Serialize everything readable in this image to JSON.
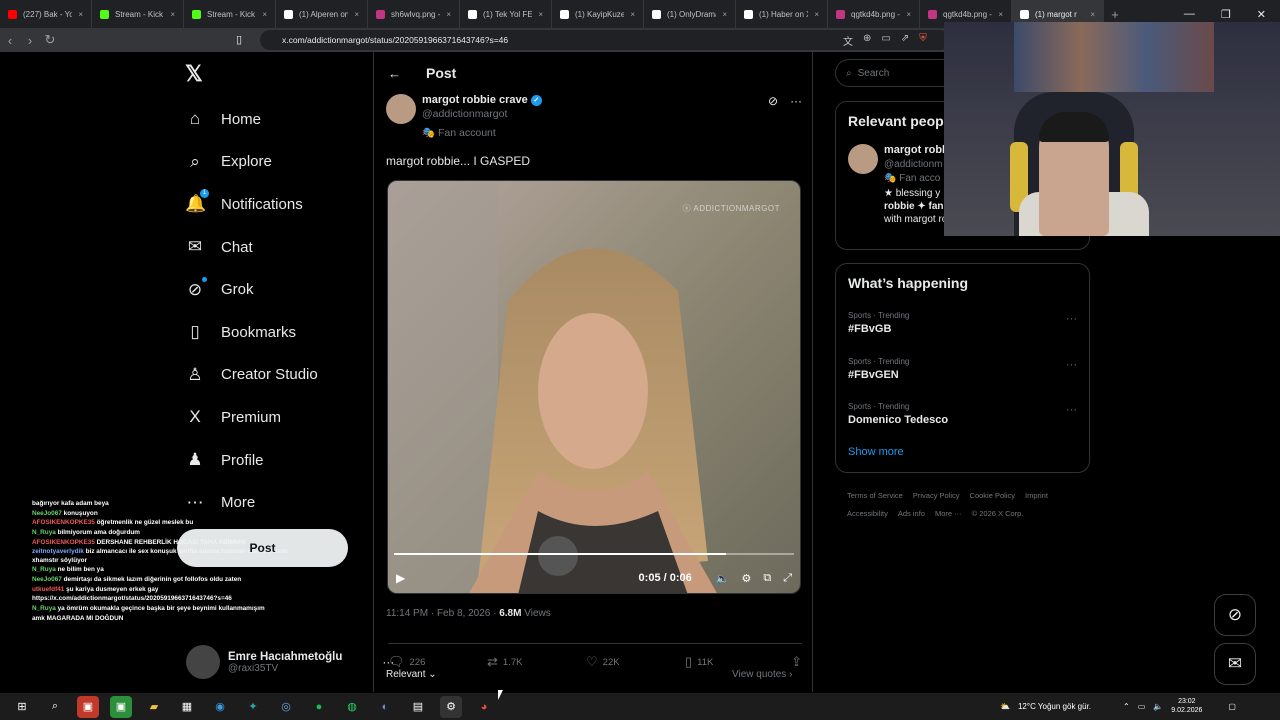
{
  "browser": {
    "tabs": [
      {
        "title": "(227) Bak - YouTu",
        "icon": "youtube-icon",
        "color": "#ff0000",
        "active": false
      },
      {
        "title": "Stream - Kick Das",
        "icon": "kick-icon",
        "color": "#53fc18",
        "active": false
      },
      {
        "title": "Stream - Kick Das",
        "icon": "kick-icon",
        "color": "#53fc18",
        "active": false
      },
      {
        "title": "(1) Alperen on X",
        "icon": "x-icon",
        "color": "#ffffff",
        "active": false
      },
      {
        "title": "sh6wlvq.png - Ho",
        "icon": "image-icon",
        "color": "#c13584",
        "active": false
      },
      {
        "title": "(1) Tek Yol FENER",
        "icon": "x-icon",
        "color": "#ffffff",
        "active": false
      },
      {
        "title": "(1) KayipKuzey o",
        "icon": "x-icon",
        "color": "#ffffff",
        "active": false
      },
      {
        "title": "(1) OnlyDrama o",
        "icon": "x-icon",
        "color": "#ffffff",
        "active": false
      },
      {
        "title": "(1) Haber on X",
        "icon": "x-icon",
        "color": "#ffffff",
        "active": false
      },
      {
        "title": "qgtkd4b.png - H",
        "icon": "image-icon",
        "color": "#c13584",
        "active": false
      },
      {
        "title": "qgtkd4b.png - H",
        "icon": "image-icon",
        "color": "#c13584",
        "active": false
      },
      {
        "title": "(1) margot r",
        "icon": "x-icon",
        "color": "#ffffff",
        "active": true
      }
    ],
    "url": "x.com/addictionmargot/status/2020591966371643746?s=46"
  },
  "sidebar": {
    "items": [
      {
        "label": "Home",
        "icon": "home-icon",
        "glyph": "⌂"
      },
      {
        "label": "Explore",
        "icon": "search-icon",
        "glyph": "⌕"
      },
      {
        "label": "Notifications",
        "icon": "bell-icon",
        "glyph": "🔔",
        "badge": "1"
      },
      {
        "label": "Chat",
        "icon": "mail-icon",
        "glyph": "✉"
      },
      {
        "label": "Grok",
        "icon": "grok-icon",
        "glyph": "⊘"
      },
      {
        "label": "Bookmarks",
        "icon": "bookmark-icon",
        "glyph": "▯"
      },
      {
        "label": "Creator Studio",
        "icon": "creator-studio-icon",
        "glyph": "♙"
      },
      {
        "label": "Premium",
        "icon": "x-premium-icon",
        "glyph": "X"
      },
      {
        "label": "Profile",
        "icon": "person-icon",
        "glyph": "♟"
      },
      {
        "label": "More",
        "icon": "more-circle-icon",
        "glyph": "⋯"
      }
    ],
    "post_button": "Post",
    "account": {
      "name": "Emre Hacıahmetoğlu",
      "handle": "@raxi35TV"
    }
  },
  "chat_overlay": [
    {
      "user": "",
      "text": "bağırıyor kafa adam beya",
      "color": "#f05a5a"
    },
    {
      "user": "NeeJo067",
      "text": "konuşuyon",
      "color": "#6bd46b"
    },
    {
      "user": "AFOSIKENKOPKE35",
      "text": "öğretmenlik ne güzel meslek bu",
      "color": "#f05a5a"
    },
    {
      "user": "N_Ruya",
      "text": "bilmiyorum ama doğurdum",
      "color": "#6bd46b"
    },
    {
      "user": "AFOSIKENKOPKE35",
      "text": "DERSHANE REHBERLİK HOCASI TAHA ABİMMM",
      "color": "#f05a5a"
    },
    {
      "user": "zeitnotyaverlydik",
      "text": "biz almancacı ile sex konuşuk sınıfta adama hamster coin diyorum xhamstır söylüyor",
      "color": "#7aa9ff"
    },
    {
      "user": "N_Ruya",
      "text": "ne bilim ben ya",
      "color": "#6bd46b"
    },
    {
      "user": "NeeJo067",
      "text": "demirtaşı da sikmek lazım diğerinin got follofos oldu zaten",
      "color": "#6bd46b"
    },
    {
      "user": "utkuefdf41",
      "text": "şu kariya dusmeyen erkek gay",
      "color": "#f05a5a"
    },
    {
      "user": "",
      "text": "https://x.com/addictionmargot/status/2020591966371643746?s=46",
      "color": "#f05a5a"
    },
    {
      "user": "N_Ruya",
      "text": "ya ömrüm okumakla geçince başka bir şeye beynimi kullanmamışım",
      "color": "#6bd46b"
    },
    {
      "user": "",
      "text": "amk MAGARADA MI DOĞDUN",
      "color": "#f05a5a"
    }
  ],
  "post": {
    "header": "Post",
    "author": {
      "name": "margot robbie crave",
      "handle": "@addictionmargot",
      "label": "Fan account"
    },
    "text": "margot robbie... I GASPED",
    "video": {
      "watermark": "ⓧ ADDICTIONMARGOT",
      "time": "0:05 / 0:06",
      "progress": 0.83
    },
    "timestamp": "11:14 PM · Feb 8, 2026 · ",
    "views": "6.8M",
    "views_label": "Views",
    "replies": "226",
    "reposts": "1.7K",
    "likes": "22K",
    "bookmarks": "11K",
    "sort": "Relevant",
    "view_quotes": "View quotes"
  },
  "right": {
    "search_placeholder": "Search",
    "relevant_title": "Relevant peop",
    "relevant_person": {
      "name": "margot robb",
      "handle": "@addictionm",
      "label": "Fan acco",
      "bio1": "★ blessing y",
      "bio2": "robbie ✦ fan",
      "bio3": "with margot robbie"
    },
    "happening_title": "What’s happening",
    "trends": [
      {
        "category": "Sports · Trending",
        "name": "#FBvGB"
      },
      {
        "category": "Sports · Trending",
        "name": "#FBvGEN"
      },
      {
        "category": "Sports · Trending",
        "name": "Domenico Tedesco"
      }
    ],
    "show_more": "Show more",
    "footer": [
      "Terms of Service",
      "Privacy Policy",
      "Cookie Policy",
      "Imprint",
      "Accessibility",
      "Ads info",
      "More ···",
      "© 2026 X Corp."
    ]
  },
  "taskbar": {
    "weather": "12°C  Yoğun gök gür.",
    "time": "23:02",
    "date": "9.02.2026"
  },
  "colors": {
    "accent": "#1d9bf0",
    "bg": "#000000",
    "border": "#2f3336"
  }
}
